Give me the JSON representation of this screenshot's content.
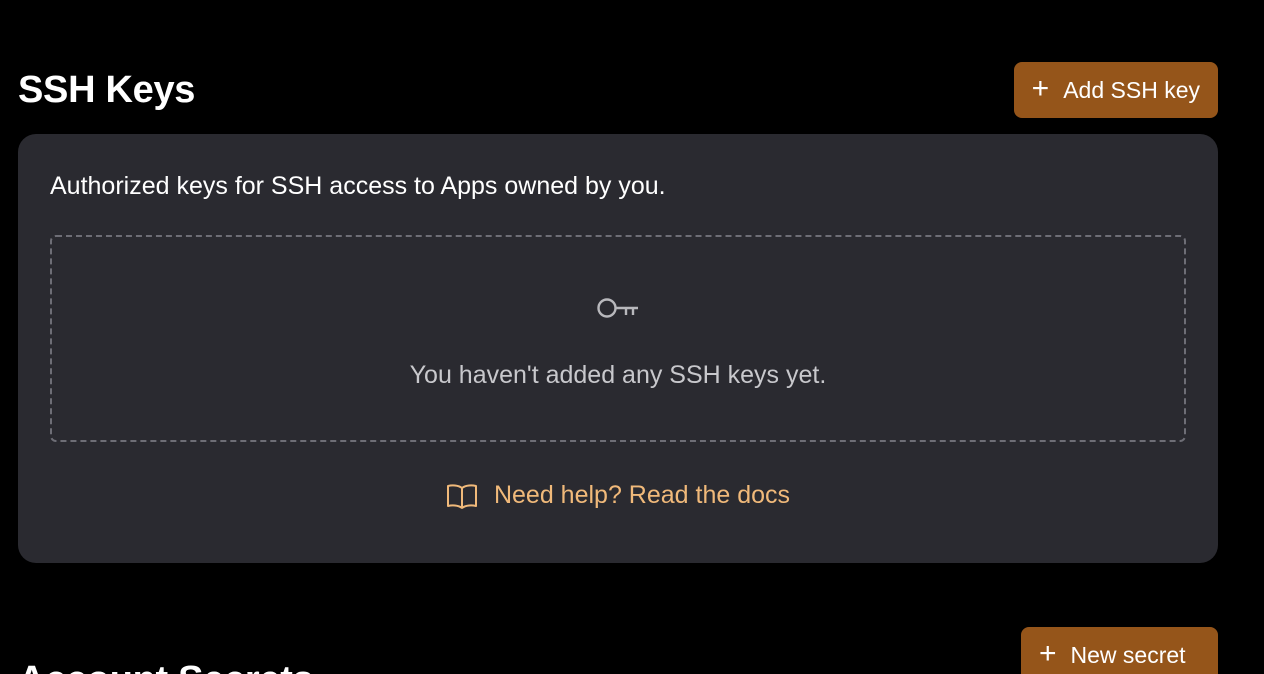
{
  "ssh_section": {
    "title": "SSH Keys",
    "add_button_label": "Add SSH key",
    "description": "Authorized keys for SSH access to Apps owned by you.",
    "empty_state_text": "You haven't added any SSH keys yet.",
    "docs_link_text": "Need help? Read the docs"
  },
  "secrets_section": {
    "title": "Account Secrets",
    "new_button_label": "New secret"
  },
  "icons": {
    "add_ssh": "plus-icon",
    "empty_state": "key-icon",
    "docs": "book-open-icon",
    "new_secret": "plus-icon"
  },
  "colors": {
    "background": "#000000",
    "card": "#2a2a30",
    "primary_button": "#95551a",
    "link": "#f0b97a",
    "muted_text": "#c8c8cc"
  }
}
